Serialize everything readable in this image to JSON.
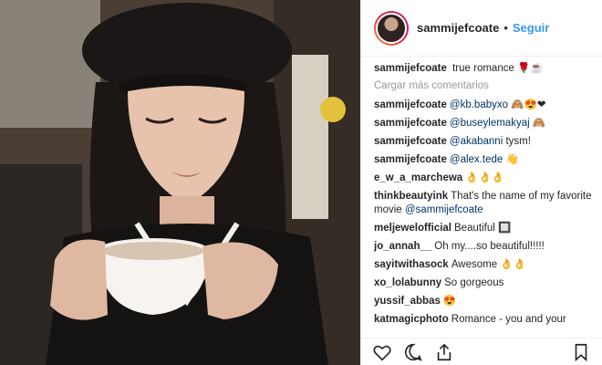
{
  "post": {
    "username": "sammijefcoate",
    "separator": "•",
    "follow_label": "Seguir"
  },
  "caption": {
    "user": "sammijefcoate",
    "text": "true romance 🌹☕"
  },
  "load_more": "Cargar más comentarios",
  "comments": [
    {
      "user": "sammijefcoate",
      "text": "@kb.babyxo 🙈😍❤"
    },
    {
      "user": "sammijefcoate",
      "text": "@buseylemakyaj 🙈"
    },
    {
      "user": "sammijefcoate",
      "text": "@akabanni tysm!"
    },
    {
      "user": "sammijefcoate",
      "text": "@alex.tede 👋"
    },
    {
      "user": "e_w_a_marchewa",
      "text": "👌👌👌"
    },
    {
      "user": "thinkbeautyink",
      "text": "That's the name of my favorite movie @sammijefcoate"
    },
    {
      "user": "meljewelofficial",
      "text": "Beautiful 🔲"
    },
    {
      "user": "jo_annah__",
      "text": "Oh my....so beautiful!!!!!"
    },
    {
      "user": "sayitwithasock",
      "text": "Awesome 👌👌"
    },
    {
      "user": "xo_lolabunny",
      "text": "So gorgeous"
    },
    {
      "user": "yussif_abbas",
      "text": "😍"
    },
    {
      "user": "katmagicphoto",
      "text": "Romance - you and your"
    }
  ],
  "icons": {
    "like": "heart-icon",
    "comment": "comment-icon",
    "share": "share-icon",
    "save": "bookmark-icon"
  },
  "colors": {
    "follow": "#3897f0",
    "text": "#262626",
    "muted": "#999999"
  }
}
